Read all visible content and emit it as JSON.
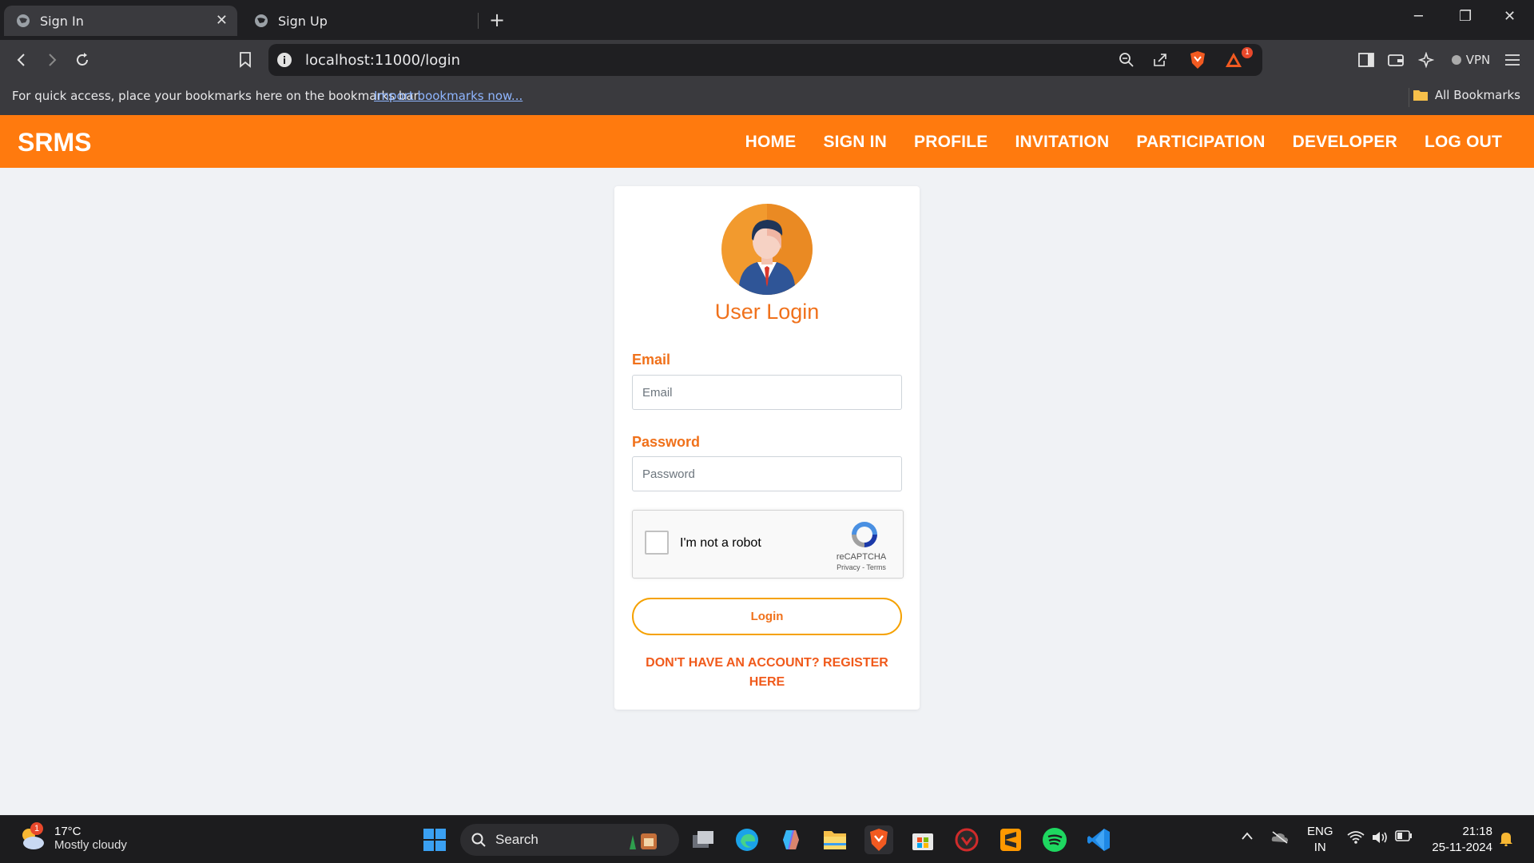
{
  "browser": {
    "tabs": [
      {
        "label": "Sign In",
        "active": true
      },
      {
        "label": "Sign Up",
        "active": false
      }
    ],
    "url": "localhost:11000/login",
    "vpn_label": "VPN",
    "notification_count": "1",
    "bookmarks_bar": {
      "message": "For quick access, place your bookmarks here on the bookmarks bar.",
      "import_link": "Import bookmarks now...",
      "all_bookmarks": "All Bookmarks"
    }
  },
  "navbar": {
    "brand": "SRMS",
    "links": [
      "HOME",
      "SIGN IN",
      "PROFILE",
      "INVITATION",
      "PARTICIPATION",
      "DEVELOPER",
      "LOG OUT"
    ]
  },
  "login": {
    "title": "User Login",
    "email_label": "Email",
    "email_placeholder": "Email",
    "password_label": "Password",
    "password_placeholder": "Password",
    "captcha_text": "I'm not a robot",
    "captcha_brand": "reCAPTCHA",
    "captcha_terms": "Privacy - Terms",
    "login_button": "Login",
    "register_link": "DON'T HAVE AN ACCOUNT? REGISTER HERE"
  },
  "taskbar": {
    "weather_temp": "17°C",
    "weather_condition": "Mostly cloudy",
    "weather_badge": "1",
    "search_label": "Search",
    "lang_line1": "ENG",
    "lang_line2": "IN",
    "time": "21:18",
    "date": "25-11-2024"
  },
  "colors": {
    "brand_orange": "#ff7a0e",
    "title_orange": "#f0711b",
    "button_border": "#f5a100"
  }
}
